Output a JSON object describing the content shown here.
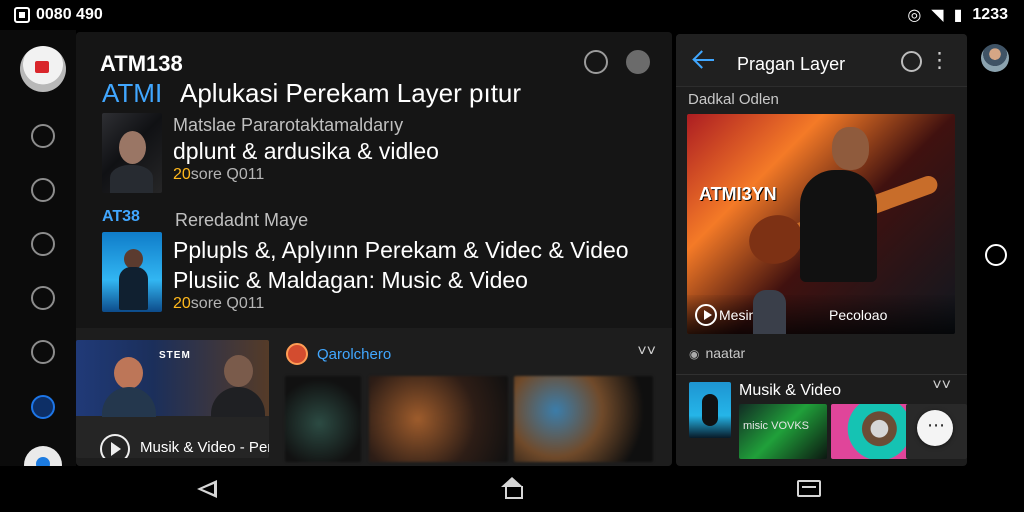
{
  "status_bar": {
    "left_text": "0080 490",
    "right_text": "1233"
  },
  "main": {
    "title": "ATM138",
    "headline": {
      "accent": "ATMI",
      "text": "Aplukasi Perekam Layer pıtur"
    },
    "posts": [
      {
        "small": "Matslae Pararotaktamaldarıy",
        "main": "dplunt & ardusika & vidleo",
        "meta_highlight": "20",
        "meta_rest": "sore Q011"
      },
      {
        "small": "Reredadnt Maye",
        "main_line_1": "Pplupls &, Aplyınn Perekam & Videc & Video",
        "main_line_2": "Plusiic & Maldagan: Music & Video",
        "meta_highlight": "20",
        "meta_rest": "sore Q011"
      }
    ],
    "section_label": "AT38",
    "promo": {
      "label": "Musik & Video - Perekam Layar",
      "tag": "STEM"
    },
    "channel": {
      "name": "Qarolchero",
      "more": "˅˅"
    }
  },
  "right_panel": {
    "title": "Pragan Layer",
    "subtitle": "Dadkal Odlen",
    "feature": {
      "tag": "ATMI3YN",
      "left_label": "Mesinta",
      "right_label": "Pecoloao"
    },
    "time_text": "naatar",
    "section_title": "Musik & Video",
    "section_more": "˅˅",
    "tile_label": "misic VOVKS"
  },
  "colors": {
    "accent_blue": "#41a7ff",
    "highlight_yellow": "#ffb81c",
    "panel_bg": "#181818"
  },
  "icons": {
    "status": [
      "square-status-icon",
      "wifi-icon",
      "battery-icon"
    ],
    "main_header": [
      "search-icon",
      "more-circle-icon"
    ],
    "right_header": [
      "back-arrow-icon",
      "search-icon",
      "vertical-more-icon"
    ],
    "navigation": [
      "back-icon",
      "home-icon",
      "recent-apps-icon"
    ]
  }
}
